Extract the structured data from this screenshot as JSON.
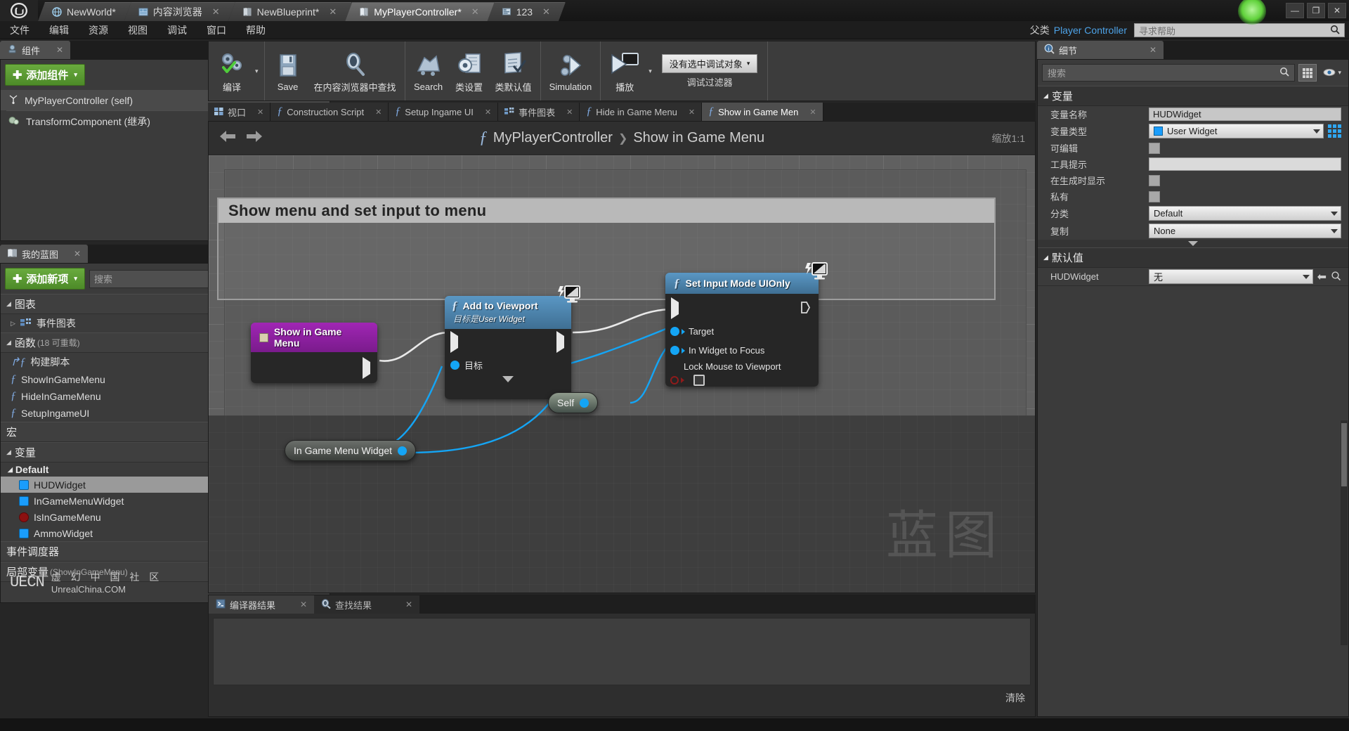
{
  "window": {
    "logo": "UE",
    "tabs": [
      {
        "label": "NewWorld*",
        "icon": "world-icon",
        "active": false,
        "closable": false
      },
      {
        "label": "内容浏览器",
        "icon": "content-browser-icon",
        "active": false,
        "closable": true
      },
      {
        "label": "NewBlueprint*",
        "icon": "blueprint-icon",
        "active": false,
        "closable": true
      },
      {
        "label": "MyPlayerController*",
        "icon": "blueprint-icon",
        "active": true,
        "closable": true
      },
      {
        "label": "123",
        "icon": "widget-icon",
        "active": false,
        "closable": true
      }
    ],
    "controls": {
      "minimize": "—",
      "maximize": "▭",
      "restore": "❐",
      "close": "✕"
    }
  },
  "menubar": {
    "items": [
      "文件",
      "编辑",
      "资源",
      "视图",
      "调试",
      "窗口",
      "帮助"
    ],
    "parent_class_label": "父类",
    "parent_class_value": "Player Controller",
    "help_placeholder": "寻求帮助",
    "help_icon": "search-icon"
  },
  "toolbar": {
    "groups": [
      {
        "buttons": [
          {
            "label": "编译",
            "icon": "compile-icon",
            "has_caret": true
          }
        ]
      },
      {
        "buttons": [
          {
            "label": "Save",
            "icon": "save-icon",
            "has_caret": false
          },
          {
            "label": "在内容浏览器中查找",
            "icon": "find-in-cb-icon",
            "has_caret": false
          }
        ]
      },
      {
        "buttons": [
          {
            "label": "Search",
            "icon": "search-icon",
            "has_caret": false
          },
          {
            "label": "类设置",
            "icon": "class-settings-icon",
            "has_caret": false
          },
          {
            "label": "类默认值",
            "icon": "class-defaults-icon",
            "has_caret": false
          }
        ]
      },
      {
        "buttons": [
          {
            "label": "Simulation",
            "icon": "simulate-icon",
            "has_caret": false
          }
        ]
      },
      {
        "buttons": [
          {
            "label": "播放",
            "icon": "play-icon",
            "has_caret": true
          }
        ]
      }
    ],
    "debug": {
      "selected": "没有选中调试对象",
      "caret": "▾",
      "label": "调试过滤器"
    }
  },
  "components_panel": {
    "tab_label": "组件",
    "tab_icon": "components-icon",
    "tab_close": "✕",
    "add_button": "添加组件",
    "add_plus": "✚",
    "add_caret": "▾",
    "rows": [
      {
        "label": "MyPlayerController (self)",
        "icon": "actor-icon",
        "selected": true
      },
      {
        "label": "TransformComponent (继承)",
        "icon": "transform-icon",
        "selected": false
      }
    ]
  },
  "myblueprint_panel": {
    "tab_label": "我的蓝图",
    "tab_icon": "blueprint-icon",
    "tab_close": "✕",
    "add_button": "添加新项",
    "add_plus": "✚",
    "add_caret": "▾",
    "search_placeholder": "搜索",
    "search_icon": "search-icon",
    "eye_icon": "eye-icon",
    "sections": [
      {
        "title": "图表",
        "sub": "",
        "plus": "✚"
      },
      {
        "title": "函数",
        "sub": "(18 可重载)",
        "plus": "✚"
      },
      {
        "title": "宏",
        "sub": "",
        "plus": "✚"
      },
      {
        "title": "变量",
        "sub": "",
        "plus": "✚"
      },
      {
        "title": "事件调度器",
        "sub": "",
        "plus": "✚"
      },
      {
        "title": "局部变量",
        "sub": "(ShowInGameMenu)",
        "plus": "✚"
      }
    ],
    "graph_items": [
      {
        "label": "事件图表",
        "icon": "event-graph-icon"
      }
    ],
    "function_items": [
      {
        "label": "构建脚本",
        "icon": "construction-script-icon"
      },
      {
        "label": "ShowInGameMenu",
        "icon": "function-icon"
      },
      {
        "label": "HideInGameMenu",
        "icon": "function-icon"
      },
      {
        "label": "SetupIngameUI",
        "icon": "function-icon"
      }
    ],
    "variable_category": "Default",
    "variable_items": [
      {
        "label": "HUDWidget",
        "type_color": "#1a9dfc",
        "shape": "square",
        "selected": true,
        "right_icon": "visibility-line"
      },
      {
        "label": "InGameMenuWidget",
        "type_color": "#1a9dfc",
        "shape": "square",
        "selected": false,
        "right_icon": "visibility-line"
      },
      {
        "label": "IsInGameMenu",
        "type_color": "#8c1111",
        "shape": "pill",
        "selected": false,
        "right_icon": "visibility-line"
      },
      {
        "label": "AmmoWidget",
        "type_color": "#1a9dfc",
        "shape": "square",
        "selected": false,
        "right_icon": "eye-icon"
      }
    ],
    "watermark": {
      "mark": "UECN",
      "line1": "虚 幻 中 国 社 区",
      "line2": "UnrealChina.COM"
    }
  },
  "graph_tabs": [
    {
      "label": "视口",
      "icon": "viewport-icon",
      "active": false,
      "close": "✕"
    },
    {
      "label": "Construction Script",
      "icon": "function-icon",
      "active": false,
      "close": "✕"
    },
    {
      "label": "Setup Ingame UI",
      "icon": "function-icon",
      "active": false,
      "close": "✕"
    },
    {
      "label": "事件图表",
      "icon": "event-graph-icon",
      "active": false,
      "close": "✕"
    },
    {
      "label": "Hide in Game Menu",
      "icon": "function-icon",
      "active": false,
      "close": "✕"
    },
    {
      "label": "Show in Game Men",
      "icon": "function-icon",
      "active": true,
      "close": "✕"
    }
  ],
  "graph": {
    "back_icon": "arrow-left-icon",
    "forward_icon": "arrow-right-icon",
    "breadcrumb_fn_icon": "function-icon",
    "breadcrumb_root": "MyPlayerController",
    "breadcrumb_sep": "❯",
    "breadcrumb_leaf": "Show in Game Menu",
    "zoom_label": "缩放1:1",
    "watermark": "蓝图",
    "comment": "Show menu and set input to menu",
    "nodes": [
      {
        "id": "show-in-game-menu-entry",
        "title": "Show in Game Menu",
        "icon": "entry-node-icon",
        "kind": "event-entry"
      },
      {
        "id": "add-to-viewport",
        "title": "Add to Viewport",
        "subtitle_prefix": "目标是",
        "subtitle_value": "User Widget",
        "icon": "function-icon",
        "corner_icon": "non-pure-latent-icon",
        "pins": [
          {
            "label": "目标",
            "type": "object"
          }
        ],
        "expander": "▼"
      },
      {
        "id": "set-input-mode-uionly",
        "title": "Set Input Mode UIOnly",
        "icon": "function-icon",
        "corner_icon": "non-pure-latent-icon",
        "pins": [
          {
            "label": "Target",
            "type": "object"
          },
          {
            "label": "In Widget to Focus",
            "type": "object"
          },
          {
            "label": "Lock Mouse to Viewport",
            "type": "boolean",
            "checked": false
          }
        ]
      },
      {
        "id": "self-node",
        "title": "Self",
        "kind": "variable-get"
      },
      {
        "id": "in-game-menu-widget-node",
        "title": "In Game Menu Widget",
        "kind": "variable-get"
      }
    ]
  },
  "results_panel": {
    "tabs": [
      {
        "label": "编译器结果",
        "icon": "compiler-results-icon",
        "active": true,
        "close": "✕"
      },
      {
        "label": "查找结果",
        "icon": "find-results-icon",
        "active": false,
        "close": "✕"
      }
    ],
    "clear_button": "清除"
  },
  "details_panel": {
    "tab_label": "细节",
    "tab_icon": "details-icon",
    "tab_close": "✕",
    "search_placeholder": "搜索",
    "search_icon": "search-icon",
    "grid_icon": "grid-view-icon",
    "eye_icon": "eye-icon",
    "sections": [
      {
        "title": "变量",
        "rows": [
          {
            "label": "变量名称",
            "kind": "text",
            "value": "HUDWidget"
          },
          {
            "label": "变量类型",
            "kind": "type",
            "value": "User Widget",
            "color": "#1a9dfc"
          },
          {
            "label": "可编辑",
            "kind": "checkbox",
            "value": ""
          },
          {
            "label": "工具提示",
            "kind": "text",
            "value": ""
          },
          {
            "label": "在生成时显示",
            "kind": "checkbox",
            "value": ""
          },
          {
            "label": "私有",
            "kind": "checkbox",
            "value": ""
          },
          {
            "label": "分类",
            "kind": "select",
            "value": "Default"
          },
          {
            "label": "复制",
            "kind": "select",
            "value": "None"
          }
        ]
      },
      {
        "title": "默认值",
        "rows": [
          {
            "label": "HUDWidget",
            "kind": "asset-select",
            "value": "无"
          }
        ]
      }
    ]
  }
}
